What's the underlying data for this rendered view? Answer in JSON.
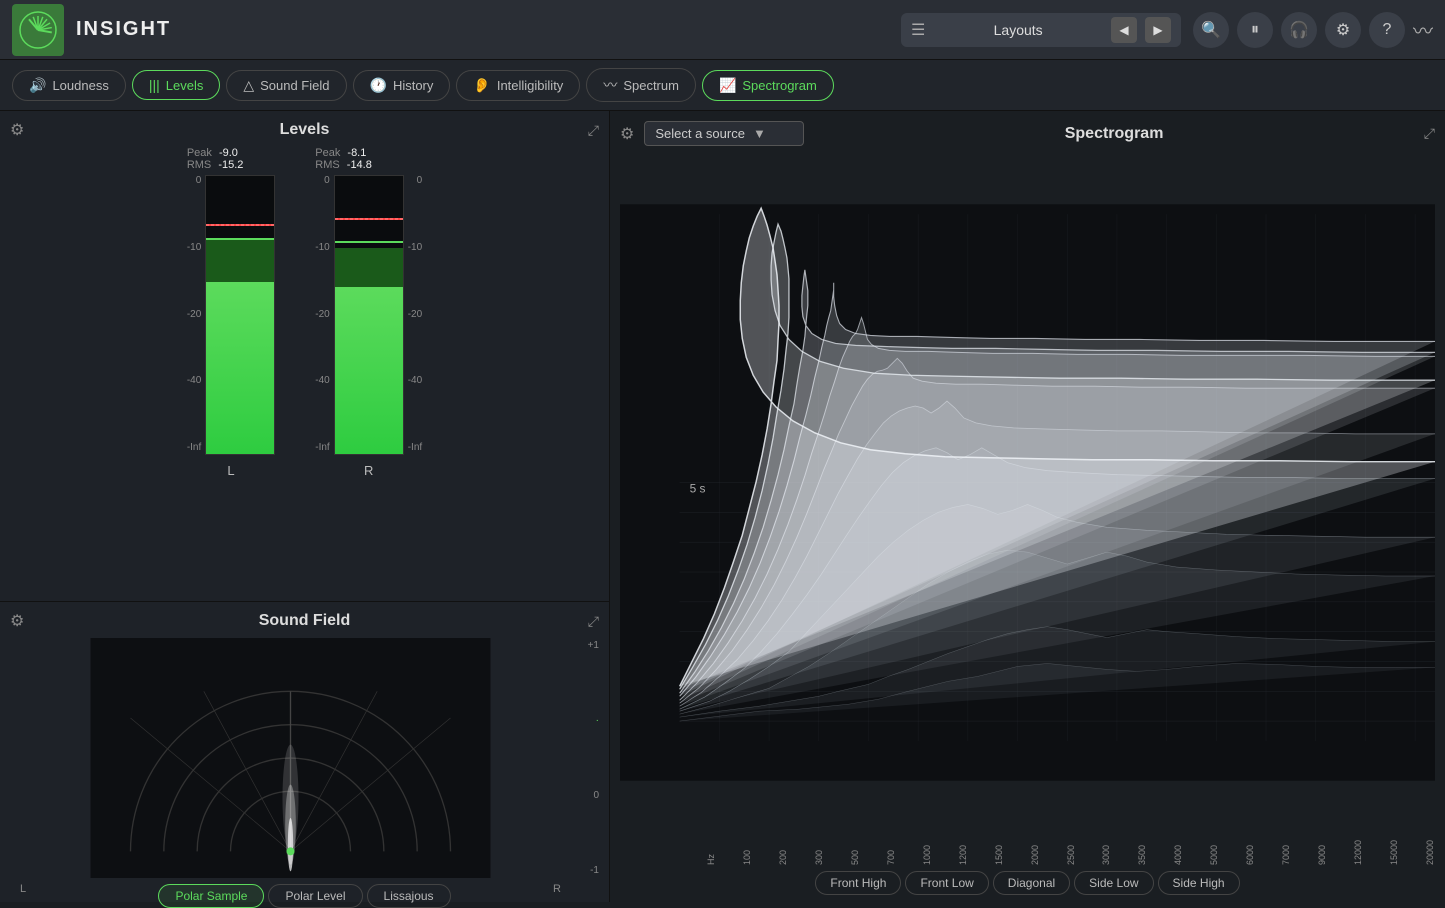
{
  "app": {
    "title": "INSIGHT",
    "logo_alt": "Insight Logo"
  },
  "header": {
    "layouts_label": "Layouts",
    "prev_arrow": "◀",
    "next_arrow": "▶"
  },
  "tabs": [
    {
      "id": "loudness",
      "label": "Loudness",
      "icon": "🔊",
      "active": false
    },
    {
      "id": "levels",
      "label": "Levels",
      "icon": "📊",
      "active": true
    },
    {
      "id": "soundfield",
      "label": "Sound Field",
      "icon": "🔺",
      "active": false
    },
    {
      "id": "history",
      "label": "History",
      "icon": "🕐",
      "active": false
    },
    {
      "id": "intelligibility",
      "label": "Intelligibility",
      "icon": "👂",
      "active": false
    },
    {
      "id": "spectrum",
      "label": "Spectrum",
      "icon": "〰",
      "active": false
    },
    {
      "id": "spectrogram",
      "label": "Spectrogram",
      "icon": "📈",
      "active": true
    }
  ],
  "levels": {
    "title": "Levels",
    "channels": [
      {
        "id": "L",
        "label": "L",
        "peak_label": "Peak",
        "rms_label": "RMS",
        "peak_value": "-9.0",
        "rms_value": "-15.2",
        "fill_height_pct": 62,
        "dark_height_pct": 15,
        "peak_pos_pct": 82,
        "rms_pos_pct": 75
      },
      {
        "id": "R",
        "label": "R",
        "peak_label": "Peak",
        "rms_label": "RMS",
        "peak_value": "-8.1",
        "rms_value": "-14.8",
        "fill_height_pct": 60,
        "dark_height_pct": 14,
        "peak_pos_pct": 84,
        "rms_pos_pct": 76
      }
    ],
    "scale": [
      "0",
      "-10",
      "-20",
      "-40",
      "-Inf"
    ]
  },
  "soundfield": {
    "title": "Sound Field",
    "scale_labels": [
      "+1",
      "0",
      "-1"
    ],
    "channel_labels": [
      "L",
      "R"
    ],
    "view_tabs": [
      {
        "id": "polar_sample",
        "label": "Polar Sample",
        "active": true
      },
      {
        "id": "polar_level",
        "label": "Polar Level",
        "active": false
      },
      {
        "id": "lissajous",
        "label": "Lissajous",
        "active": false
      }
    ]
  },
  "spectrogram": {
    "title": "Spectrogram",
    "source_label": "Select a source",
    "source_arrow": "▼",
    "time_label": "5 s",
    "freq_labels": [
      "Hz",
      "100",
      "200",
      "300",
      "500",
      "700",
      "1000",
      "1200",
      "1500",
      "2000",
      "2500",
      "3000",
      "3500",
      "4000",
      "5000",
      "6000",
      "7000",
      "9000",
      "12000",
      "15000",
      "20000"
    ],
    "view_tabs": [
      {
        "id": "front_high",
        "label": "Front High"
      },
      {
        "id": "front_low",
        "label": "Front Low"
      },
      {
        "id": "diagonal",
        "label": "Diagonal"
      },
      {
        "id": "side_low",
        "label": "Side Low"
      },
      {
        "id": "side_high",
        "label": "Side High"
      }
    ]
  },
  "colors": {
    "accent_green": "#5cdb5c",
    "bg_dark": "#1a1e22",
    "bg_panel": "#1e2228",
    "bg_header": "#2a2e35",
    "border": "#333"
  }
}
